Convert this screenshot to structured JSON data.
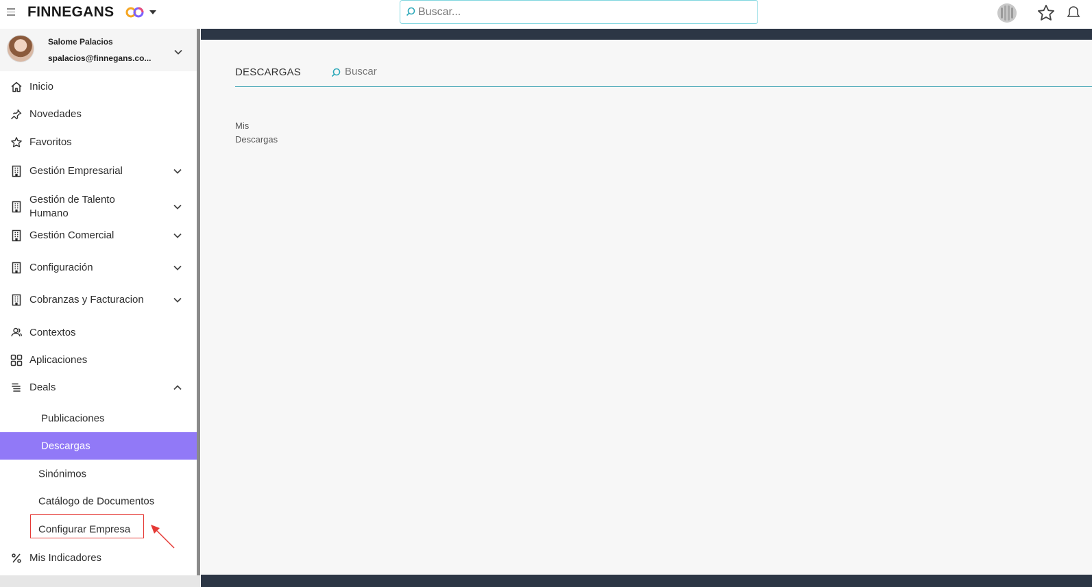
{
  "header": {
    "brand": "FINNEGANS",
    "search_placeholder": "Buscar..."
  },
  "user": {
    "name": "Salome Palacios",
    "email": "spalacios@finnegans.co..."
  },
  "sidebar": {
    "items": [
      {
        "label": "Inicio"
      },
      {
        "label": "Novedades"
      },
      {
        "label": "Favoritos"
      },
      {
        "label": "Gestión Empresarial"
      },
      {
        "label": "Gestión de Talento Humano"
      },
      {
        "label": "Gestión Comercial"
      },
      {
        "label": "Configuración"
      },
      {
        "label": "Cobranzas y Facturacion"
      },
      {
        "label": "Contextos"
      },
      {
        "label": "Aplicaciones"
      },
      {
        "label": "Deals"
      },
      {
        "label": "Mis Indicadores"
      }
    ],
    "deals_children": [
      {
        "label": "Publicaciones"
      },
      {
        "label": "Descargas",
        "active": true
      },
      {
        "label": "Sinónimos"
      },
      {
        "label": "Catálogo de Documentos"
      },
      {
        "label": "Configurar Empresa",
        "highlighted": true
      }
    ]
  },
  "main": {
    "title": "DESCARGAS",
    "search_label": "Buscar",
    "section_label": "Mis Descargas"
  },
  "colors": {
    "accent_active": "#9179f7",
    "dark_bar": "#2c3645",
    "search_border": "#7fd6df",
    "divider": "#4aa8b8",
    "annotation": "#e53935"
  }
}
